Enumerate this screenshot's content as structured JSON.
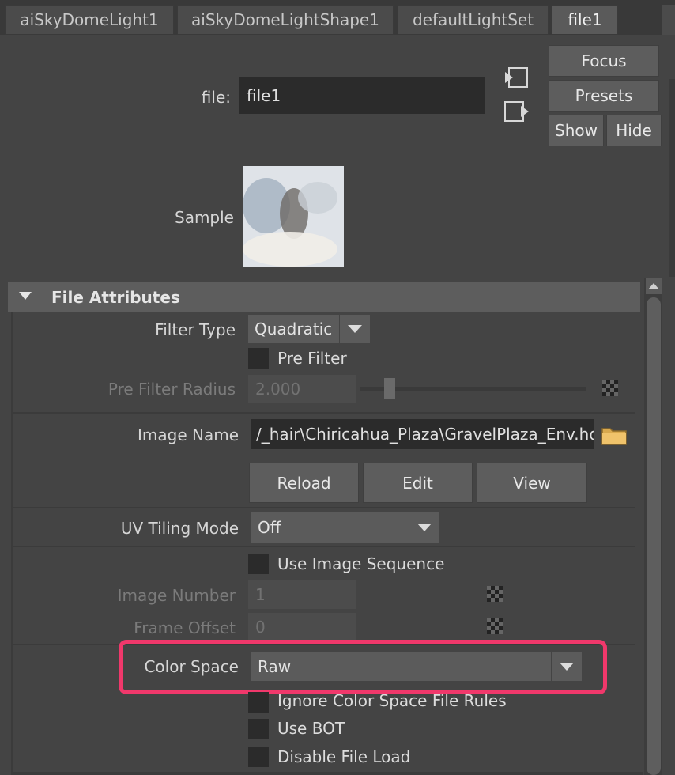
{
  "tabs": [
    {
      "label": "aiSkyDomeLight1"
    },
    {
      "label": "aiSkyDomeLightShape1"
    },
    {
      "label": "defaultLightSet"
    },
    {
      "label": "file1"
    }
  ],
  "header": {
    "file_label": "file:",
    "file_value": "file1",
    "focus": "Focus",
    "presets": "Presets",
    "show": "Show",
    "hide": "Hide",
    "sample_label": "Sample"
  },
  "section": {
    "title": "File Attributes"
  },
  "attrs": {
    "filter_type_label": "Filter Type",
    "filter_type_value": "Quadratic",
    "pre_filter_label": "Pre Filter",
    "pre_filter_radius_label": "Pre Filter Radius",
    "pre_filter_radius_value": "2.000",
    "image_name_label": "Image Name",
    "image_name_value": "/_hair\\Chiricahua_Plaza\\GravelPlaza_Env.hdr",
    "reload": "Reload",
    "edit": "Edit",
    "view": "View",
    "uv_tiling_label": "UV Tiling Mode",
    "uv_tiling_value": "Off",
    "use_image_sequence": "Use Image Sequence",
    "image_number_label": "Image Number",
    "image_number_value": "1",
    "frame_offset_label": "Frame Offset",
    "frame_offset_value": "0",
    "color_space_label": "Color Space",
    "color_space_value": "Raw",
    "ignore_rules": "Ignore Color Space File Rules",
    "use_bot": "Use BOT",
    "disable_file_load": "Disable File Load"
  },
  "colors": {
    "highlight": "#f0386b",
    "panel": "#444444",
    "field": "#2b2b2b"
  }
}
